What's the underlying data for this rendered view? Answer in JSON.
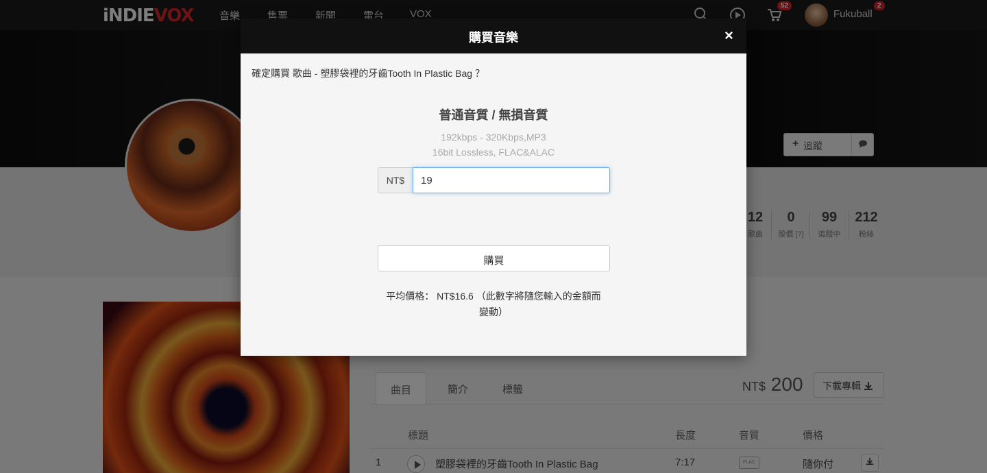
{
  "nav": {
    "logo_main": "iNDIE",
    "logo_accent": "VOX",
    "items": [
      "音樂",
      "售票",
      "新聞",
      "電台",
      "VOX"
    ],
    "cart_count": "52",
    "notification_count": "2",
    "username": "Fukuball"
  },
  "artist": {
    "follow_label": "追蹤",
    "stats": [
      {
        "num": "12",
        "label": "歌曲"
      },
      {
        "num": "0",
        "label": "股價 [?]"
      },
      {
        "num": "99",
        "label": "追蹤中"
      },
      {
        "num": "212",
        "label": "粉絲"
      }
    ]
  },
  "album": {
    "tabs": [
      "曲目",
      "簡介",
      "標籤"
    ],
    "price_currency": "NT$",
    "price_value": "200",
    "download_label": "下載專輯",
    "table_headers": {
      "title": "標題",
      "length": "長度",
      "quality": "音質",
      "price": "價格"
    },
    "tracks": [
      {
        "no": "1",
        "title": "塑膠袋裡的牙齒Tooth In Plastic Bag",
        "length": "7:17",
        "quality": "FLAC",
        "price": "隨你付"
      }
    ]
  },
  "modal": {
    "title": "購買音樂",
    "close": "×",
    "confirm_text": "確定購買 歌曲 - 塑膠袋裡的牙齒Tooth In Plastic Bag ？",
    "quality_title": "普通音質 / 無損音質",
    "spec_line1": "192kbps - 320Kbps,MP3",
    "spec_line2": "16bit Lossless, FLAC&ALAC",
    "currency_addon": "NT$",
    "amount_value": "19",
    "buy_label": "購買",
    "avg_price_line1": "平均價格： NT$16.6 （此數字將隨您輸入的金額而",
    "avg_price_line2": "變動）"
  }
}
